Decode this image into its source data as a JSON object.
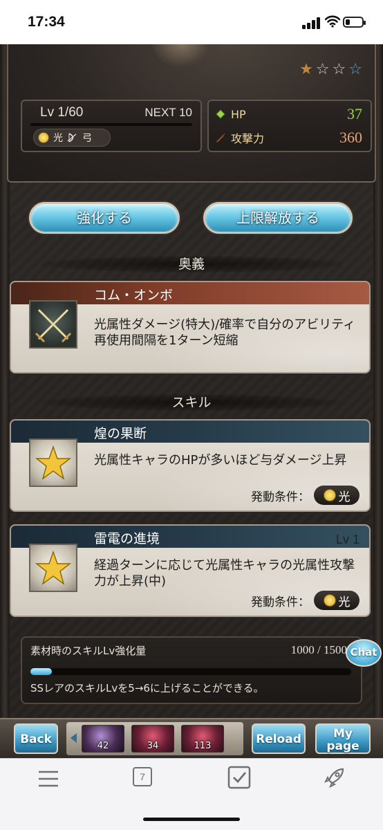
{
  "status": {
    "time": "17:34",
    "battery_level": 0.25
  },
  "unit": {
    "level_label": "Lv 1/60",
    "next_label": "NEXT 10",
    "element": "光",
    "weapon_type": "弓",
    "rarity_stars": 4,
    "uncapped_stars": 1,
    "stats": {
      "hp_label": "HP",
      "hp_value": "37",
      "atk_label": "攻撃力",
      "atk_value": "360",
      "hp_color": "#9ad64c",
      "atk_color": "#f0a070"
    }
  },
  "buttons": {
    "upgrade": "強化する",
    "uncap": "上限解放する"
  },
  "sections": {
    "ougi": "奥義",
    "skill": "スキル"
  },
  "ougi": {
    "name": "コム・オンボ",
    "description": "光属性ダメージ(特大)/確率で自分のアビリティ再使用間隔を1ターン短縮",
    "icon": "crossed-swords-icon"
  },
  "skills": [
    {
      "name": "煌の果断",
      "description": "光属性キャラのHPが多いほど与ダメージ上昇",
      "condition_label": "発動条件：",
      "condition_element": "光",
      "level": "",
      "icon": "star-icon"
    },
    {
      "name": "雷電の進境",
      "description": "経過ターンに応じて光属性キャラの光属性攻撃力が上昇(中)",
      "condition_label": "発動条件：",
      "condition_element": "光",
      "level": "Lv 1",
      "icon": "star-icon"
    }
  ],
  "material": {
    "title": "素材時のスキルLv強化量",
    "count": "1000 / 1500",
    "progress": 0.0667,
    "note": "SSレアのスキルLvを5→6に上げることができる。"
  },
  "chat_label": "Chat",
  "gamebar": {
    "back": "Back",
    "reload": "Reload",
    "mypage_line1": "My",
    "mypage_line2": "page",
    "party_counts": [
      "42",
      "34",
      "113"
    ]
  },
  "browser": {
    "tab_count": "7"
  }
}
